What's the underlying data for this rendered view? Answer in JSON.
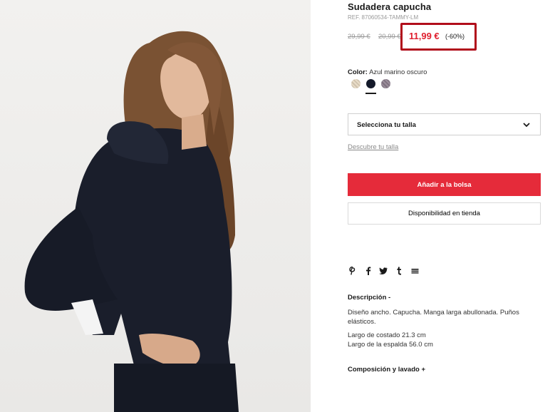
{
  "product": {
    "title": "Sudadera capucha",
    "ref": "REF. 87060534-TAMMY-LM",
    "old_price_1": "29,99 €",
    "old_price_2": "20,99 €",
    "current_price": "11,99 €",
    "discount": "(-60%)"
  },
  "color": {
    "label": "Color:",
    "value": "Azul marino oscuro",
    "swatches": [
      {
        "name": "beige",
        "color": "#e0d3bd"
      },
      {
        "name": "navy",
        "color": "#141a2a",
        "selected": true
      },
      {
        "name": "mauve",
        "color": "#8e818f"
      }
    ]
  },
  "size": {
    "select_label": "Selecciona tu talla",
    "guide_link": "Descubre tu talla"
  },
  "actions": {
    "add_to_bag": "Añadir a la bolsa",
    "store_availability": "Disponibilidad en tienda"
  },
  "share_icons": [
    "pinterest-icon",
    "facebook-icon",
    "twitter-icon",
    "tumblr-icon",
    "email-icon"
  ],
  "description": {
    "heading": "Descripción  -",
    "text": "Diseño ancho. Capucha. Manga larga abullonada. Puños elásticos.",
    "measure_1": "Largo de costado 21.3 cm",
    "measure_2": "Largo de la espalda 56.0 cm"
  },
  "composition": {
    "heading": "Composición y lavado  +"
  },
  "colors": {
    "accent_red": "#e52b3a",
    "price_red": "#e0202f",
    "highlight_border": "#b10d1b"
  }
}
